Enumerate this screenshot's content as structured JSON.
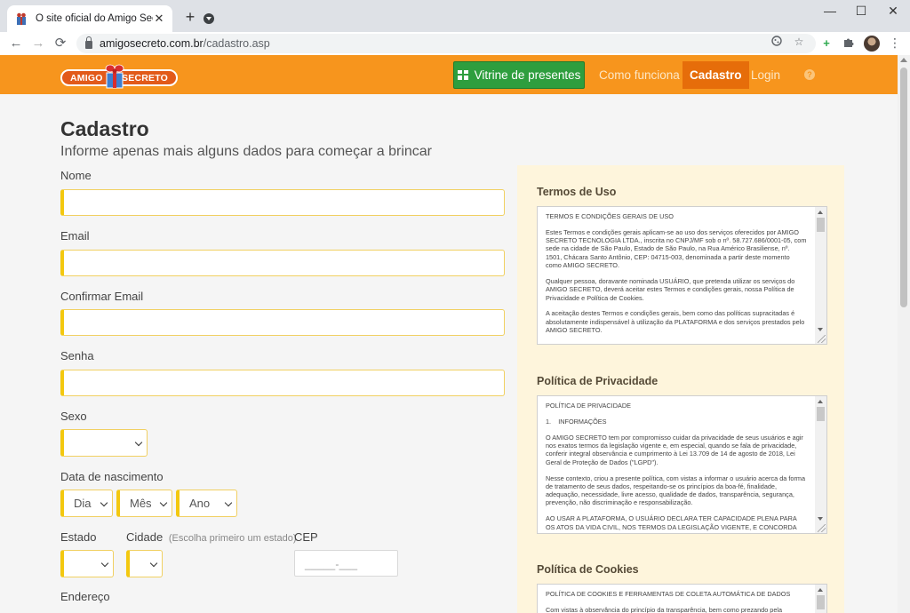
{
  "browser": {
    "tab_title": "O site oficial do Amigo Secreto",
    "tab_close": "✕",
    "new_tab": "+",
    "url_host": "amigosecreto.com.br",
    "url_path": "/cadastro.asp",
    "back": "←",
    "forward": "→",
    "reload": "⟳",
    "minimize": "—",
    "maximize": "☐",
    "close": "✕",
    "menu": "⋮"
  },
  "header": {
    "logo_left": "AMIGO",
    "logo_right": "SECRETO",
    "vitrine_label": "Vitrine de presentes",
    "nav": [
      "Como funciona",
      "Cadastro",
      "Login"
    ],
    "help": "?",
    "accent": "#f7951d",
    "active_tab_color": "#e66d0a",
    "button_green": "#2e9e3e"
  },
  "form": {
    "title": "Cadastro",
    "subtitle": "Informe apenas mais alguns dados para começar a brincar",
    "labels": {
      "nome": "Nome",
      "email": "Email",
      "confirmar_email": "Confirmar Email",
      "senha": "Senha",
      "sexo": "Sexo",
      "data_nascimento": "Data de nascimento",
      "estado": "Estado",
      "cidade": "Cidade",
      "cidade_hint": "(Escolha primeiro um estado)",
      "cep": "CEP",
      "endereco": "Endereço"
    },
    "selects": {
      "sexo": "",
      "dia": "Dia",
      "mes": "Mês",
      "ano": "Ano",
      "estado": "",
      "cidade": ""
    },
    "cep_mask": "_____-___",
    "input_border_color": "#f3c80f"
  },
  "sidebar": {
    "termos": {
      "heading": "Termos de Uso",
      "paragraphs": [
        "TERMOS E CONDIÇÕES GERAIS DE USO",
        "Estes Termos e condições gerais aplicam-se ao uso dos serviços oferecidos por AMIGO SECRETO TECNOLOGIA LTDA., inscrita no CNPJ/MF sob o nº. 58.727.686/0001-05, com sede na cidade de São Paulo, Estado de São Paulo, na Rua Américo Brasiliense, nº. 1501, Chácara Santo Antônio, CEP: 04715-003, denominada a partir deste momento como AMIGO SECRETO.",
        "Qualquer pessoa, doravante nominada USUÁRIO, que pretenda utilizar os serviços do AMIGO SECRETO, deverá aceitar estes Termos e condições gerais, nossa Política de Privacidade e Política de Cookies.",
        "A aceitação destes Termos e condições gerais, bem como das políticas supracitadas é absolutamente indispensável à utilização da PLATAFORMA e dos serviços prestados pelo AMIGO SECRETO."
      ]
    },
    "privacidade": {
      "heading": "Política de Privacidade",
      "paragraphs": [
        "POLÍTICA DE PRIVACIDADE",
        "1.    INFORMAÇÕES",
        "O AMIGO SECRETO tem por compromisso cuidar da privacidade de seus usuários e agir nos exatos termos da legislação vigente e, em especial, quando se fala de privacidade, conferir integral observância e cumprimento à Lei 13.709 de 14 de agosto de 2018, Lei Geral de Proteção de Dados (\"LGPD\").",
        "Nesse contexto, criou a presente política, com vistas a informar o usuário acerca da forma de tratamento de seus dados, respeitando-se os princípios da boa-fé, finalidade, adequação, necessidade, livre acesso, qualidade de dados, transparência, segurança, prevenção, não discriminação e responsabilização.",
        "AO USAR A PLATAFORMA, O USUÁRIO DECLARA TER CAPACIDADE PLENA PARA OS ATOS DA VIDA CIVIL, NOS TERMOS DA LEGISLAÇÃO VIGENTE, E CONCORDA"
      ]
    },
    "cookies": {
      "heading": "Política de Cookies",
      "paragraphs": [
        "POLÍTICA DE COOKIES E FERRAMENTAS DE COLETA AUTOMÁTICA DE DADOS",
        "Com vistas à observância do princípio da transparência, bem como prezando pela"
      ]
    },
    "background": "#fef5dc"
  }
}
